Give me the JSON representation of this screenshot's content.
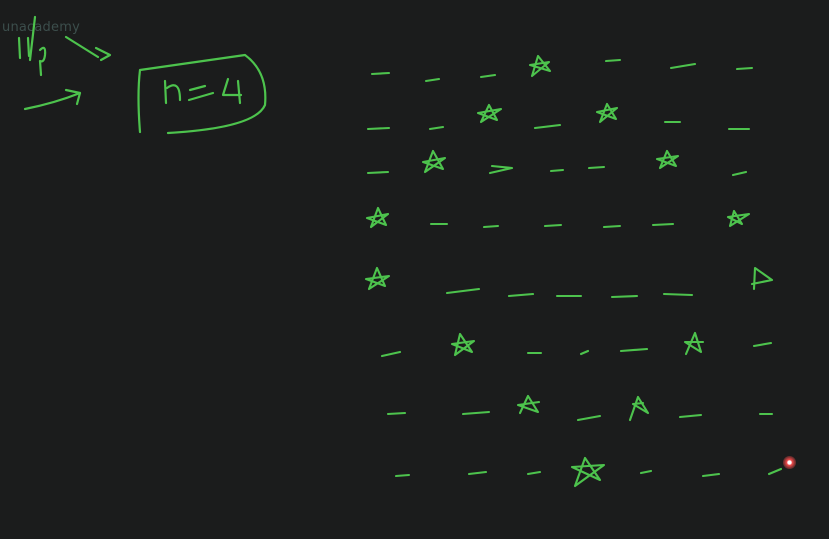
{
  "watermark": {
    "text": "unacademy"
  },
  "whiteboard": {
    "input_label": "I/P",
    "boxed_text": "n=4",
    "ink_color": "#4dc34d",
    "background_color": "#1b1c1c",
    "pattern_rows": [
      "- - - * - - -",
      "- - * - * - -",
      "- * - - - * -",
      "* - - - - - *",
      "* - - - - - *",
      "- * - - - * -",
      "- - * - * - -",
      "- - - * - - -"
    ]
  },
  "laser_pointer": {
    "color": "#f04a4a"
  }
}
